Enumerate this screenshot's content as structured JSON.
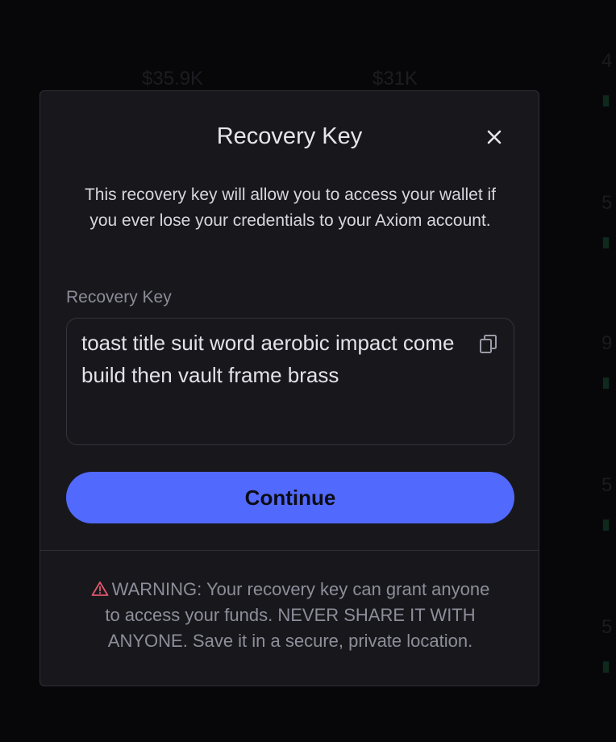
{
  "background": {
    "price_left": "$35.9K",
    "price_right": "$31K",
    "edge_digits": [
      "4",
      "5",
      "9",
      "5",
      "5"
    ]
  },
  "modal": {
    "title": "Recovery Key",
    "description": "This recovery key will allow you to access your wallet if you ever lose your credentials to your Axiom account.",
    "field_label": "Recovery Key",
    "recovery_key": "toast title suit word aerobic impact come build then vault frame brass",
    "continue_label": "Continue",
    "warning_text": "WARNING: Your recovery key can grant anyone to access your funds. NEVER SHARE IT WITH ANYONE. Save it in a secure, private location."
  },
  "icons": {
    "close": "close-icon",
    "copy": "copy-icon",
    "warning": "warning-triangle-icon"
  },
  "colors": {
    "accent": "#5169fd",
    "warning_icon": "#e0586e",
    "modal_bg": "#18181c"
  }
}
